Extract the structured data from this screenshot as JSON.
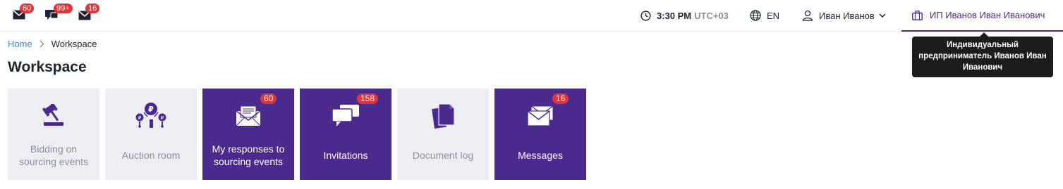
{
  "topbar": {
    "notifications": [
      {
        "icon": "envelope-icon",
        "count": "60"
      },
      {
        "icon": "chat-icon",
        "count": "99+"
      },
      {
        "icon": "envelope-stack-icon",
        "count": "16"
      }
    ],
    "time": {
      "value": "3:30 PM",
      "timezone": "UTC+03",
      "icon": "clock-icon"
    },
    "language": {
      "value": "EN",
      "icon": "globe-icon"
    },
    "user": {
      "name": "Иван Иванов",
      "icon": "user-icon"
    },
    "organization": {
      "name": "ИП Иванов Иван Иванович",
      "icon": "briefcase-icon"
    }
  },
  "tooltip": {
    "text": "Индивидуальный предприниматель Иванов Иван Иванович"
  },
  "breadcrumb": {
    "home": "Home",
    "current": "Workspace"
  },
  "page": {
    "title": "Workspace"
  },
  "tiles": [
    {
      "label": "Bidding on sourcing events",
      "icon": "gavel-icon",
      "style": "light",
      "badge": ""
    },
    {
      "label": "Auction room",
      "icon": "auction-icon",
      "style": "light",
      "badge": ""
    },
    {
      "label": "My responses to sourcing events",
      "icon": "envelope-letter-icon",
      "style": "dark",
      "badge": "60"
    },
    {
      "label": "Invitations",
      "icon": "chat-bubbles-icon",
      "style": "dark",
      "badge": "158"
    },
    {
      "label": "Document log",
      "icon": "documents-icon",
      "style": "light",
      "badge": ""
    },
    {
      "label": "Messages",
      "icon": "envelopes-icon",
      "style": "dark",
      "badge": "16"
    }
  ],
  "colors": {
    "brand": "#4a2a8c",
    "badge": "#e0363b",
    "tile_light": "#eceef2",
    "link": "#4a86c5"
  }
}
